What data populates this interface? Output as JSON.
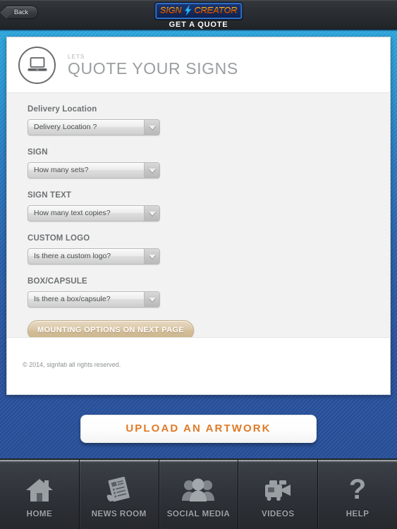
{
  "topbar": {
    "back_label": "Back",
    "logo": {
      "word1": "SIGN",
      "word2": "CREATOR",
      "bolt_icon": "lightning-bolt-icon"
    },
    "title": "GET A QUOTE"
  },
  "card": {
    "header": {
      "icon": "laptop-icon",
      "eyebrow": "LETS",
      "title": "QUOTE YOUR SIGNS"
    },
    "fields": [
      {
        "label": "Delivery Location",
        "value": "Delivery Location ?",
        "name": "delivery-location"
      },
      {
        "label": "SIGN",
        "value": "How many sets?",
        "name": "sign"
      },
      {
        "label": "SIGN TEXT",
        "value": "How many text copies?",
        "name": "sign-text"
      },
      {
        "label": "CUSTOM LOGO",
        "value": "Is there a custom logo?",
        "name": "custom-logo"
      },
      {
        "label": "BOX/CAPSULE",
        "value": "Is there a box/capsule?",
        "name": "box-capsule"
      }
    ],
    "next_button": "MOUNTING OPTIONS ON NEXT PAGE",
    "copyright": "© 2014, signfab all rights reserved."
  },
  "upload_button": "UPLOAD AN ARTWORK",
  "tabbar": {
    "items": [
      {
        "label": "HOME",
        "icon": "home-icon"
      },
      {
        "label": "NEWS ROOM",
        "icon": "newspaper-icon"
      },
      {
        "label": "SOCIAL MEDIA",
        "icon": "people-icon"
      },
      {
        "label": "VIDEOS",
        "icon": "video-camera-icon"
      },
      {
        "label": "HELP",
        "icon": "question-mark-icon"
      }
    ]
  },
  "colors": {
    "accent_orange": "#e07a27",
    "brand_blue": "#2f6ec4",
    "bg_blue_top": "#2fa9e0",
    "bg_blue_bottom": "#28509b",
    "button_tan": "#d3bd98"
  }
}
